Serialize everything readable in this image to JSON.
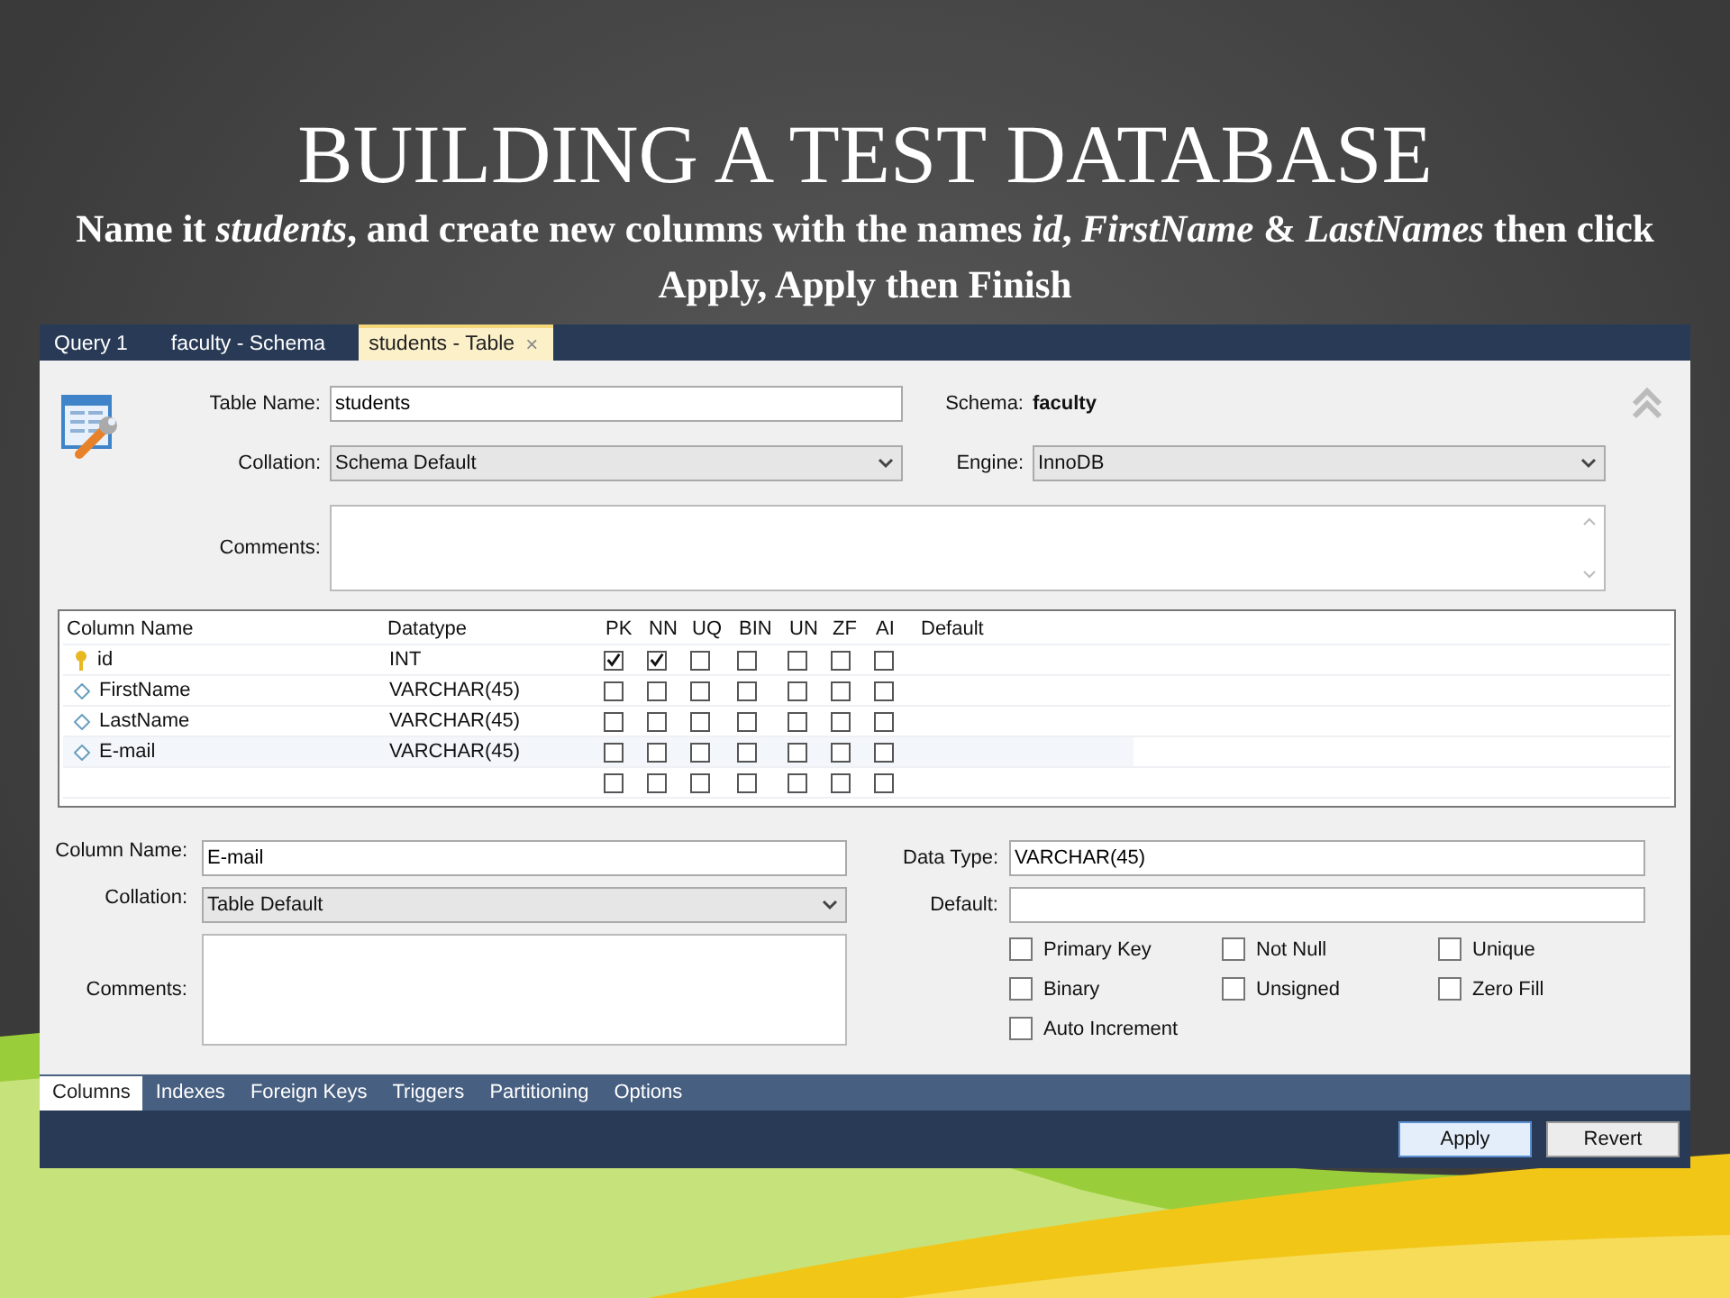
{
  "slide": {
    "title": "BUILDING A TEST DATABASE",
    "subtitle": "Name it *students*, and create new columns with the names *id*, *FirstName* & *LastNames* then click Apply, Apply then Finish"
  },
  "doc_tabs": [
    {
      "label": "Query 1",
      "selected": false
    },
    {
      "label": "faculty - Schema",
      "selected": false
    },
    {
      "label": "students - Table",
      "selected": true,
      "close": "×"
    }
  ],
  "table_form": {
    "table_name_label": "Table Name:",
    "table_name": "students",
    "schema_label": "Schema:",
    "schema": "faculty",
    "collation_label": "Collation:",
    "collation": "Schema Default",
    "engine_label": "Engine:",
    "engine": "InnoDB",
    "comments_label": "Comments:"
  },
  "columns_grid": {
    "headers": [
      "Column Name",
      "Datatype",
      "PK",
      "NN",
      "UQ",
      "BIN",
      "UN",
      "ZF",
      "AI",
      "Default"
    ],
    "rows": [
      {
        "kind": "key",
        "name": "id",
        "datatype": "INT",
        "selected": false,
        "flags": [
          true,
          true,
          false,
          false,
          false,
          false,
          false
        ]
      },
      {
        "kind": "column",
        "name": "FirstName",
        "datatype": "VARCHAR(45)",
        "selected": false,
        "flags": [
          false,
          false,
          false,
          false,
          false,
          false,
          false
        ]
      },
      {
        "kind": "column",
        "name": "LastName",
        "datatype": "VARCHAR(45)",
        "selected": false,
        "flags": [
          false,
          false,
          false,
          false,
          false,
          false,
          false
        ]
      },
      {
        "kind": "column",
        "name": "E-mail",
        "datatype": "VARCHAR(45)",
        "selected": true,
        "flags": [
          false,
          false,
          false,
          false,
          false,
          false,
          false
        ]
      },
      {
        "kind": "new",
        "selected": false,
        "flags": [
          false,
          false,
          false,
          false,
          false,
          false,
          false
        ]
      }
    ]
  },
  "column_editor": {
    "column_name_label": "Column Name:",
    "column_name": "E-mail",
    "collation_label": "Collation:",
    "collation": "Table Default",
    "comments_label": "Comments:",
    "data_type_label": "Data Type:",
    "data_type": "VARCHAR(45)",
    "default_label": "Default:",
    "options": [
      {
        "label": "Primary Key",
        "checked": false
      },
      {
        "label": "Not Null",
        "checked": false
      },
      {
        "label": "Unique",
        "checked": false
      },
      {
        "label": "Binary",
        "checked": false
      },
      {
        "label": "Unsigned",
        "checked": false
      },
      {
        "label": "Zero Fill",
        "checked": false
      },
      {
        "label": "Auto Increment",
        "checked": false
      }
    ]
  },
  "bottom_tabs": [
    {
      "label": "Columns",
      "selected": true
    },
    {
      "label": "Indexes",
      "selected": false
    },
    {
      "label": "Foreign Keys",
      "selected": false
    },
    {
      "label": "Triggers",
      "selected": false
    },
    {
      "label": "Partitioning",
      "selected": false
    },
    {
      "label": "Options",
      "selected": false
    }
  ],
  "buttons": [
    {
      "label": "Apply",
      "kind": "default"
    },
    {
      "label": "Revert",
      "kind": "normal"
    }
  ]
}
